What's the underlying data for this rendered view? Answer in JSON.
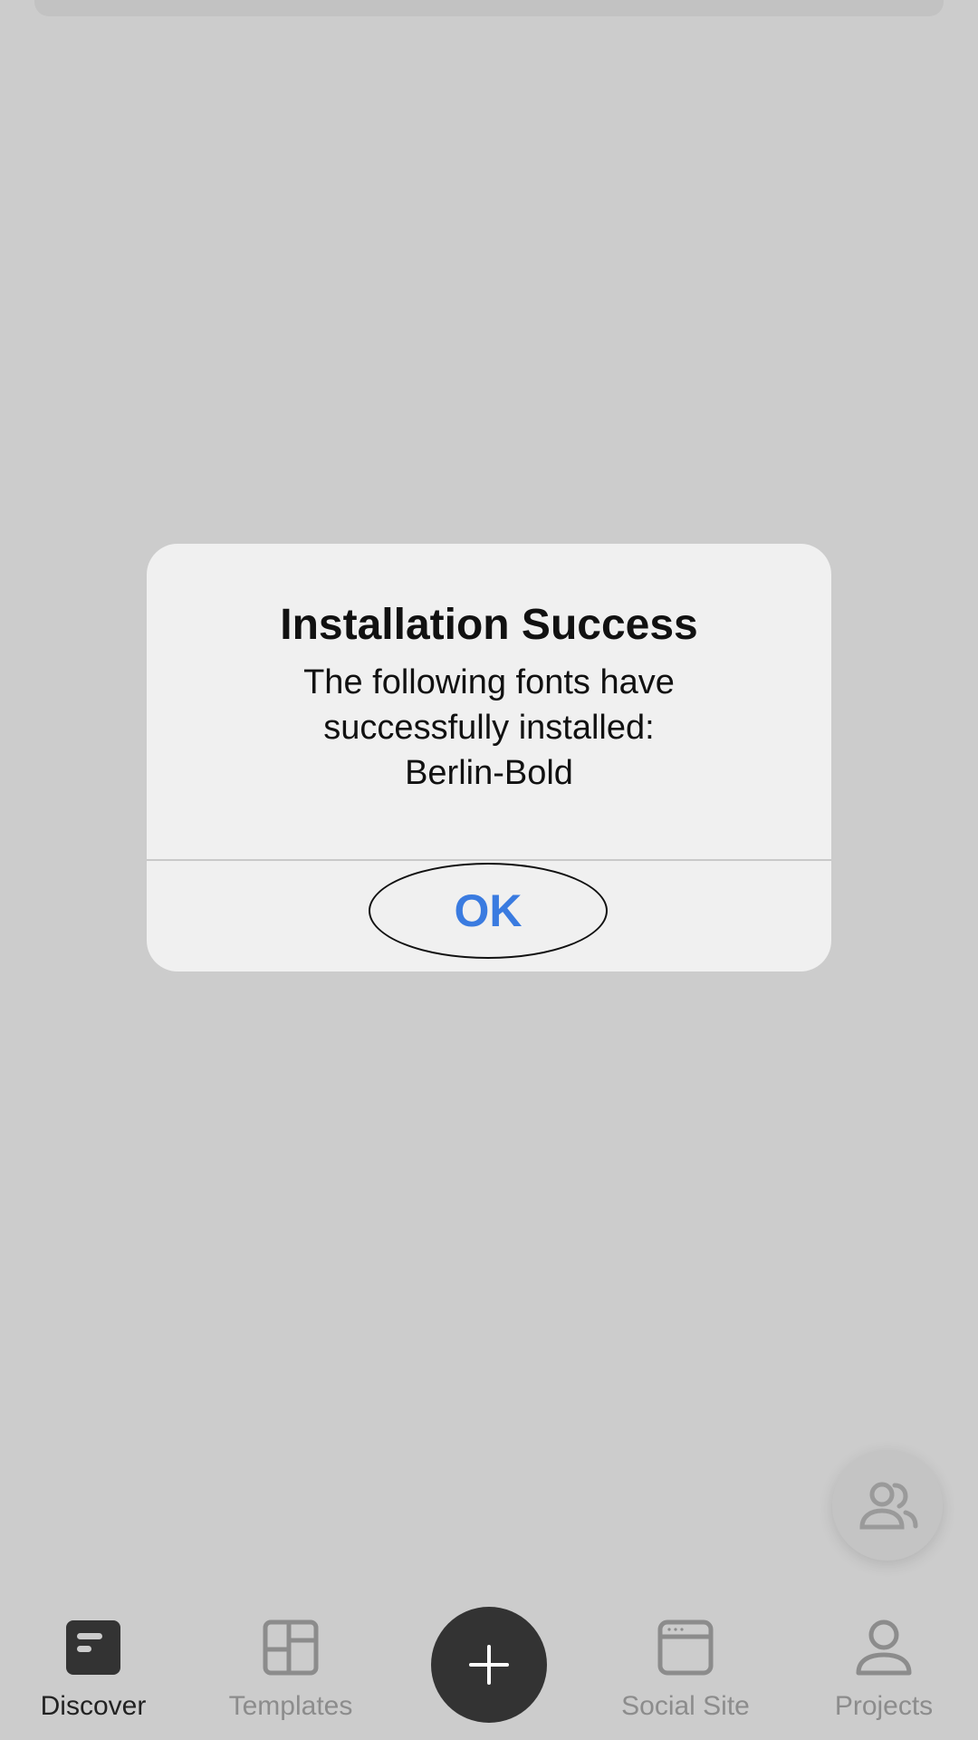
{
  "alert": {
    "title": "Installation Success",
    "message_lines": [
      "The following fonts have",
      "successfully installed:",
      "Berlin-Bold"
    ],
    "ok_label": "OK"
  },
  "floating_button": {
    "icon": "community-icon"
  },
  "tabbar": {
    "tabs": [
      {
        "label": "Discover",
        "icon": "discover-icon",
        "active": true
      },
      {
        "label": "Templates",
        "icon": "templates-icon",
        "active": false
      },
      {
        "label": "Social Site",
        "icon": "social-site-icon",
        "active": false
      },
      {
        "label": "Projects",
        "icon": "projects-icon",
        "active": false
      }
    ],
    "create_icon": "plus-icon"
  },
  "colors": {
    "overlay_background": "#cccccc",
    "alert_background": "#f0f0f0",
    "ok_text": "#3a7be0",
    "active_tab": "#222222",
    "inactive_tab": "#8c8c8c",
    "create_button": "#333333"
  }
}
